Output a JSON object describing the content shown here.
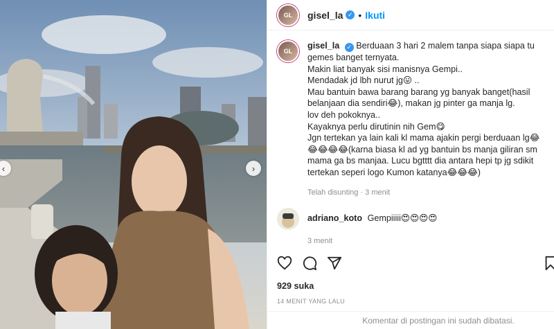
{
  "post": {
    "username": "gisel_la",
    "follow_label": "Ikuti",
    "separator": "•",
    "verified_mark": "✓",
    "avatar_text": "GL"
  },
  "caption": {
    "username": "gisel_la",
    "lines": [
      "Berduaan 3 hari 2 malem tanpa siapa siapa tu gemes banget ternyata.",
      "Makin liat banyak sisi manisnya Gempi..",
      "Mendadak jd lbh nurut jg😛 ..",
      "Mau bantuin bawa barang barang yg banyak banget(hasil belanjaan dia sendiri😂), makan jg pinter ga manja lg.",
      "lov deh pokoknya..",
      "Kayaknya perlu dirutinin nih Gem😋",
      "Jgn tertekan ya lain kali kl mama ajakin pergi berduaan lg😂😂😂😂😂(karna biasa kl ad yg bantuin bs manja giliran sm mama ga bs manjaa. Lucu bgtttt dia antara hepi tp jg sdikit tertekan seperi logo Kumon katanya😂😂😂)"
    ],
    "meta": "Telah disunting · 3 menit"
  },
  "comment": {
    "username": "adriano_koto",
    "text": "Gempiiiii😍😍😍😍",
    "meta": "3 menit"
  },
  "actions": {
    "likes": "929 suka",
    "timestamp": "14 MENIT YANG LALU"
  },
  "footer": {
    "text": "Komentar di postingan ini sudah dibatasi."
  },
  "icons": {
    "like": "heart-icon",
    "comment": "comment-icon",
    "share": "share-icon",
    "save": "bookmark-icon",
    "prev": "chevron-left-icon",
    "next": "chevron-right-icon"
  },
  "colors": {
    "accent": "#0095f6",
    "verified": "#3897f0",
    "muted": "#8e8e8e"
  }
}
